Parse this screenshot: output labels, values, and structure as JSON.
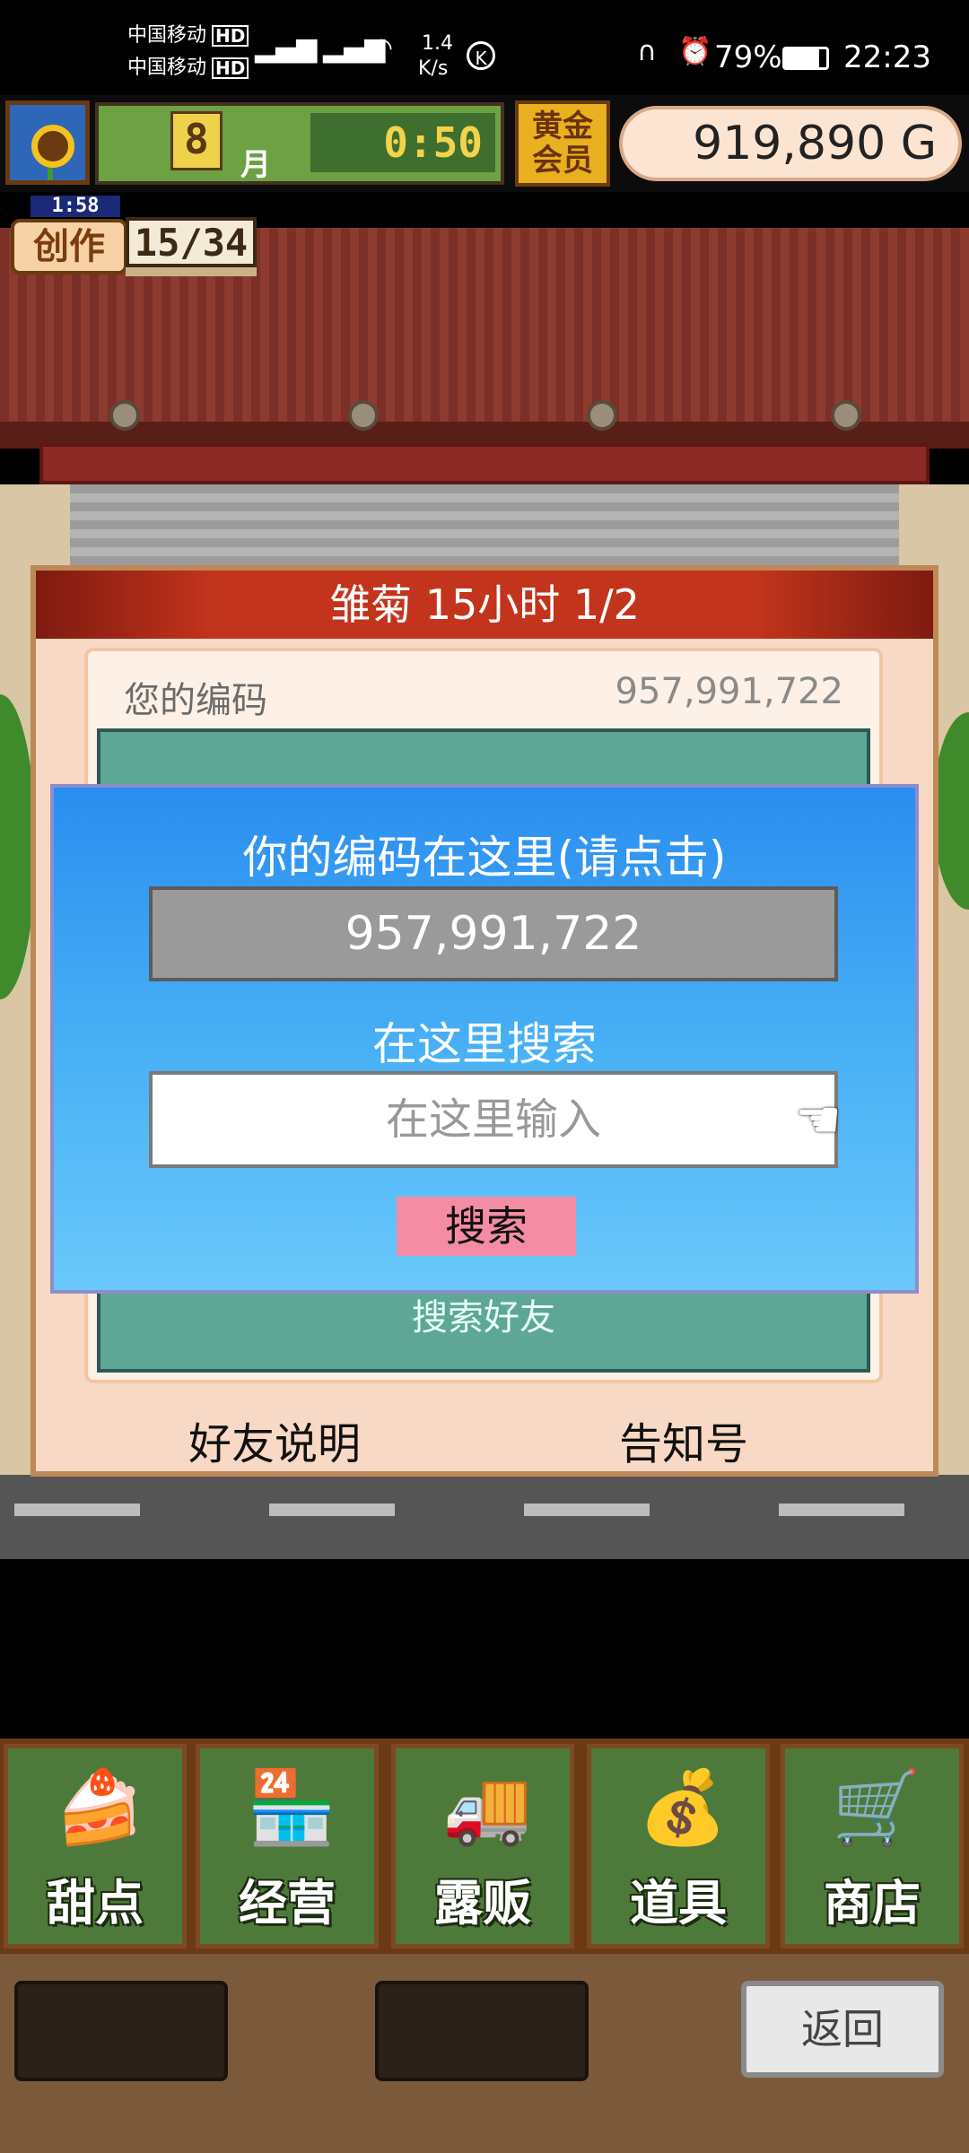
{
  "status_bar": {
    "carrier1": "中国移动",
    "carrier2": "中国移动",
    "network_speed": "1.4",
    "speed_unit": "K/s",
    "battery": "79%",
    "time": "22:23"
  },
  "hud": {
    "month_number": "8",
    "month_label": "月",
    "clock": "0:50",
    "gold_member": "黄金会员",
    "money": "919,890 G"
  },
  "creation": {
    "timer": "1:58",
    "label": "创作",
    "count": "15/34"
  },
  "friend_panel": {
    "title": "雏菊  15小时 1/2",
    "code_label": "您的编码",
    "code_value": "957,991,722",
    "search_friend_top": "搜索好友",
    "search_friend_bottom": "搜索好友",
    "footer_left": "好友说明",
    "footer_right": "告知号"
  },
  "dialog": {
    "title": "你的编码在这里(请点击)",
    "code": "957,991,722",
    "search_title": "在这里搜索",
    "search_placeholder": "在这里输入",
    "search_button": "搜索"
  },
  "menu": [
    {
      "label": "甜点",
      "icon": "cake-icon"
    },
    {
      "label": "经营",
      "icon": "shop-icon"
    },
    {
      "label": "露贩",
      "icon": "food-truck-icon"
    },
    {
      "label": "道具",
      "icon": "item-bag-icon"
    },
    {
      "label": "商店",
      "icon": "shopping-cart-icon"
    }
  ],
  "dock": {
    "back_button": "返回"
  }
}
